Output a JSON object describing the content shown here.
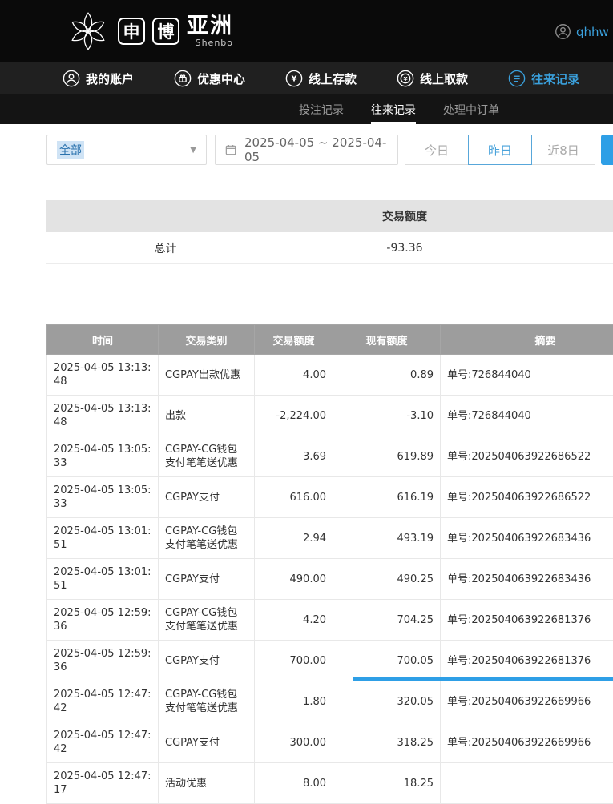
{
  "header": {
    "logo": {
      "box1": "申",
      "box2": "博",
      "region": "亚洲",
      "sub": "Shenbo"
    },
    "username": "qhhw"
  },
  "nav": {
    "items": [
      {
        "label": "我的账户",
        "icon": "user-icon",
        "active": false
      },
      {
        "label": "优惠中心",
        "icon": "gift-icon",
        "active": false
      },
      {
        "label": "线上存款",
        "icon": "deposit-coin-icon",
        "active": false
      },
      {
        "label": "线上取款",
        "icon": "withdraw-coin-icon",
        "active": false
      },
      {
        "label": "往来记录",
        "icon": "records-icon",
        "active": true
      }
    ]
  },
  "subnav": {
    "items": [
      {
        "label": "投注记录",
        "active": false
      },
      {
        "label": "往来记录",
        "active": true
      },
      {
        "label": "处理中订单",
        "active": false
      }
    ]
  },
  "filters": {
    "category_value": "全部",
    "dropdown_caret": "▼",
    "date_range": "2025-04-05 ~ 2025-04-05",
    "quick_ranges": [
      {
        "label": "今日",
        "active": false
      },
      {
        "label": "昨日",
        "active": true
      },
      {
        "label": "近8日",
        "active": false
      }
    ]
  },
  "summary": {
    "column_header": "交易额度",
    "row_label": "总计",
    "row_value": "-93.36"
  },
  "table": {
    "headers": [
      "时间",
      "交易类别",
      "交易额度",
      "现有额度",
      "摘要"
    ],
    "rows": [
      [
        "2025-04-05 13:13:48",
        "CGPAY出款优惠",
        "4.00",
        "0.89",
        "单号:726844040"
      ],
      [
        "2025-04-05 13:13:48",
        "出款",
        "-2,224.00",
        "-3.10",
        "单号:726844040"
      ],
      [
        "2025-04-05 13:05:33",
        "CGPAY-CG钱包支付笔笔送优惠",
        "3.69",
        "619.89",
        "单号:202504063922686522"
      ],
      [
        "2025-04-05 13:05:33",
        "CGPAY支付",
        "616.00",
        "616.19",
        "单号:202504063922686522"
      ],
      [
        "2025-04-05 13:01:51",
        "CGPAY-CG钱包支付笔笔送优惠",
        "2.94",
        "493.19",
        "单号:202504063922683436"
      ],
      [
        "2025-04-05 13:01:51",
        "CGPAY支付",
        "490.00",
        "490.25",
        "单号:202504063922683436"
      ],
      [
        "2025-04-05 12:59:36",
        "CGPAY-CG钱包支付笔笔送优惠",
        "4.20",
        "704.25",
        "单号:202504063922681376"
      ],
      [
        "2025-04-05 12:59:36",
        "CGPAY支付",
        "700.00",
        "700.05",
        "单号:202504063922681376"
      ],
      [
        "2025-04-05 12:47:42",
        "CGPAY-CG钱包支付笔笔送优惠",
        "1.80",
        "320.05",
        "单号:202504063922669966"
      ],
      [
        "2025-04-05 12:47:42",
        "CGPAY支付",
        "300.00",
        "318.25",
        "单号:202504063922669966"
      ],
      [
        "2025-04-05 12:47:17",
        "活动优惠",
        "8.00",
        "18.25",
        ""
      ]
    ],
    "column_aligns": [
      "left",
      "left",
      "right",
      "right",
      "left"
    ]
  },
  "colors": {
    "accent_blue": "#3aa0dc",
    "button_blue": "#2e9fe6",
    "header_bg": "#0a0a0a",
    "nav_bg": "#202020",
    "subnav_bg": "#141414",
    "table_header_bg": "#9d9d9d",
    "summary_header_bg": "#e3e3e3"
  }
}
